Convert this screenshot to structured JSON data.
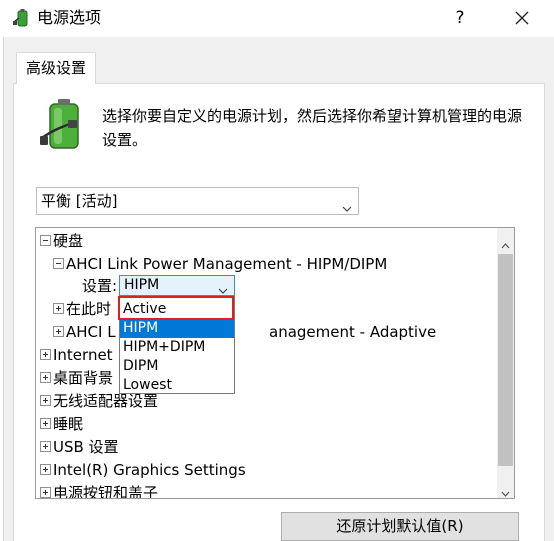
{
  "window": {
    "title": "电源选项",
    "help_label": "?",
    "close_icon": "close-icon"
  },
  "tabs": [
    {
      "label": "高级设置"
    }
  ],
  "description": "选择你要自定义的电源计划，然后选择你希望计算机管理的电源设置。",
  "plan_select": {
    "value": "平衡 [活动]"
  },
  "tree": {
    "disk": "硬盘",
    "ahci_hipm": "AHCI Link Power Management - HIPM/DIPM",
    "setting_label": "设置:",
    "setting_value": "HIPM",
    "turn_off": "在此时",
    "ahci_adaptive_prefix": "AHCI L",
    "ahci_adaptive_suffix": "anagement - Adaptive",
    "internet": "Internet",
    "desktop": "桌面背景",
    "wireless": "无线适配器设置",
    "sleep": "睡眠",
    "usb": "USB 设置",
    "intel": "Intel(R) Graphics Settings",
    "power_buttons": "电源按钮和盖子"
  },
  "dropdown_options": [
    "Active",
    "HIPM",
    "HIPM+DIPM",
    "DIPM",
    "Lowest"
  ],
  "dropdown_selected": "HIPM",
  "buttons": {
    "restore_defaults": "还原计划默认值(R)"
  },
  "colors": {
    "highlight": "#0078d7",
    "annotation_box": "#e02020"
  }
}
